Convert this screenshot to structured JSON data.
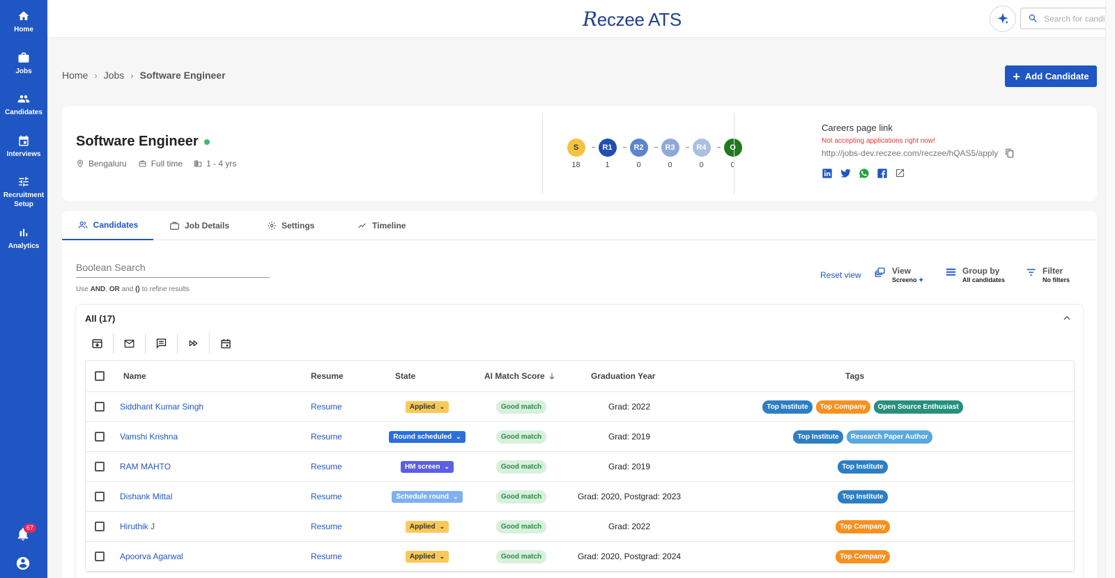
{
  "sidebar": {
    "items": [
      {
        "label": "Home",
        "icon": "home-icon"
      },
      {
        "label": "Jobs",
        "icon": "briefcase-icon"
      },
      {
        "label": "Candidates",
        "icon": "people-icon"
      },
      {
        "label": "Interviews",
        "icon": "calendar-icon"
      },
      {
        "label": "Recruitment Setup",
        "icon": "tune-icon"
      },
      {
        "label": "Analytics",
        "icon": "bar-chart-icon"
      }
    ],
    "notification_count": "67"
  },
  "header": {
    "logo_initial": "R",
    "logo_rest": "eczee ATS",
    "search_placeholder": "Search for candidates"
  },
  "breadcrumb": {
    "home": "Home",
    "jobs": "Jobs",
    "current": "Software Engineer"
  },
  "add_candidate_label": "Add Candidate",
  "job": {
    "title": "Software Engineer",
    "location": "Bengaluru",
    "type": "Full time",
    "experience": "1 - 4 yrs",
    "status_color": "#3fb96f"
  },
  "pipeline": [
    {
      "label": "S",
      "count": "18",
      "color": "#f5c242",
      "text_color": "#333"
    },
    {
      "label": "R1",
      "count": "1",
      "color": "#1f4fb0",
      "text_color": "#fff"
    },
    {
      "label": "R2",
      "count": "0",
      "color": "#5a86cc",
      "text_color": "#fff"
    },
    {
      "label": "R3",
      "count": "0",
      "color": "#8ea9d8",
      "text_color": "#fff"
    },
    {
      "label": "R4",
      "count": "0",
      "color": "#aabfe2",
      "text_color": "#fff"
    },
    {
      "label": "O",
      "count": "0",
      "color": "#1f7a1f",
      "text_color": "#fff"
    }
  ],
  "careers": {
    "title": "Careers page link",
    "warning": "Not accepting applications right now!",
    "url": "http://jobs-dev.reczee.com/reczee/hQAS5/apply"
  },
  "tabs": [
    {
      "label": "Candidates"
    },
    {
      "label": "Job Details"
    },
    {
      "label": "Settings"
    },
    {
      "label": "Timeline"
    }
  ],
  "boolean_search": {
    "placeholder": "Boolean Search",
    "hint_use": "Use",
    "hint_and": "AND",
    "hint_or": "OR",
    "hint_conj": "and",
    "hint_parens": "()",
    "hint_rest": "to refine results"
  },
  "toolbar": {
    "reset": "Reset view",
    "view_label": "View",
    "view_value": "Screeno",
    "group_label": "Group by",
    "group_value": "All candidates",
    "filter_label": "Filter",
    "filter_value": "No filters"
  },
  "list": {
    "title": "All (17)",
    "columns": {
      "name": "Name",
      "resume": "Resume",
      "state": "State",
      "score": "AI Match Score",
      "grad": "Graduation Year",
      "tags": "Tags"
    },
    "rows": [
      {
        "name": "Siddhant Kumar Singh",
        "resume": "Resume",
        "state": "Applied",
        "score": "Good match",
        "grad": "Grad: 2022",
        "tags": [
          "Top Institute",
          "Top Company",
          "Open Source Enthusiast"
        ]
      },
      {
        "name": "Vamshi Krishna",
        "resume": "Resume",
        "state": "Round scheduled",
        "score": "Good match",
        "grad": "Grad: 2019",
        "tags": [
          "Top Institute",
          "Research Paper Author"
        ]
      },
      {
        "name": "RAM MAHTO",
        "resume": "Resume",
        "state": "HM screen",
        "score": "Good match",
        "grad": "Grad: 2019",
        "tags": [
          "Top Institute"
        ]
      },
      {
        "name": "Dishank Mittal",
        "resume": "Resume",
        "state": "Schedule round",
        "score": "Good match",
        "grad": "Grad: 2020, Postgrad: 2023",
        "tags": [
          "Top Institute"
        ]
      },
      {
        "name": "Hiruthik J",
        "resume": "Resume",
        "state": "Applied",
        "score": "Good match",
        "grad": "Grad: 2022",
        "tags": [
          "Top Company"
        ]
      },
      {
        "name": "Apoorva Agarwal",
        "resume": "Resume",
        "state": "Applied",
        "score": "Good match",
        "grad": "Grad: 2020, Postgrad: 2024",
        "tags": [
          "Top Company"
        ]
      }
    ]
  },
  "state_colors": {
    "Applied": {
      "bg": "#f8c95a",
      "fg": "#333"
    },
    "Round scheduled": {
      "bg": "#2a6fdb",
      "fg": "#fff"
    },
    "HM screen": {
      "bg": "#5b5fe0",
      "fg": "#fff"
    },
    "Schedule round": {
      "bg": "#7fb0f0",
      "fg": "#fff"
    }
  },
  "tag_colors": {
    "Top Institute": "#2d7ec4",
    "Top Company": "#f7901e",
    "Open Source Enthusiast": "#26907e",
    "Research Paper Author": "#59a8de"
  }
}
